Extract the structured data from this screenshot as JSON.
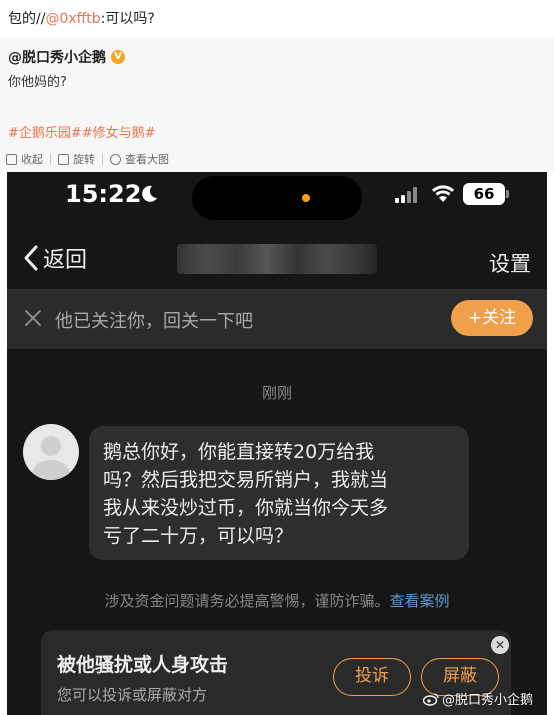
{
  "comment": {
    "prefix": "包的//",
    "mention": "@0xfftb",
    "suffix": ":可以吗?"
  },
  "retweet": {
    "author": "@脱口秀小企鹅",
    "badge_icon": "verified-badge-icon",
    "text": "你他妈的?",
    "tags": "#企鹅乐园##修女与鹅#",
    "actions": {
      "collapse": "收起",
      "rotate": "旋转",
      "view_large": "查看大图"
    }
  },
  "phone": {
    "status": {
      "time": "15:22",
      "battery": "66",
      "accent": "#ff9f0a"
    },
    "nav": {
      "back_label": "返回",
      "settings_label": "设置"
    },
    "follow_bar": {
      "text": "他已关注你，回关一下吧",
      "button": "+关注",
      "button_color": "#f0a04b"
    },
    "message": {
      "time": "刚刚",
      "lines": [
        "鹅总你好，你能直接转20万给我",
        "吗？然后我把交易所销户，我就当",
        "我从来没炒过币，你就当你今天多",
        "亏了二十万，可以吗？"
      ]
    },
    "warning": {
      "text": "涉及资金问题请务必提高警惕，谨防诈骗。",
      "link": "查看案例",
      "link_color": "#5b9bd5"
    },
    "report_card": {
      "title": "被他骚扰或人身攻击",
      "subtitle": "您可以投诉或屏蔽对方",
      "report_button": "投诉",
      "block_button": "屏蔽",
      "close": "✕"
    }
  },
  "watermark": "@脱口秀小企鹅"
}
